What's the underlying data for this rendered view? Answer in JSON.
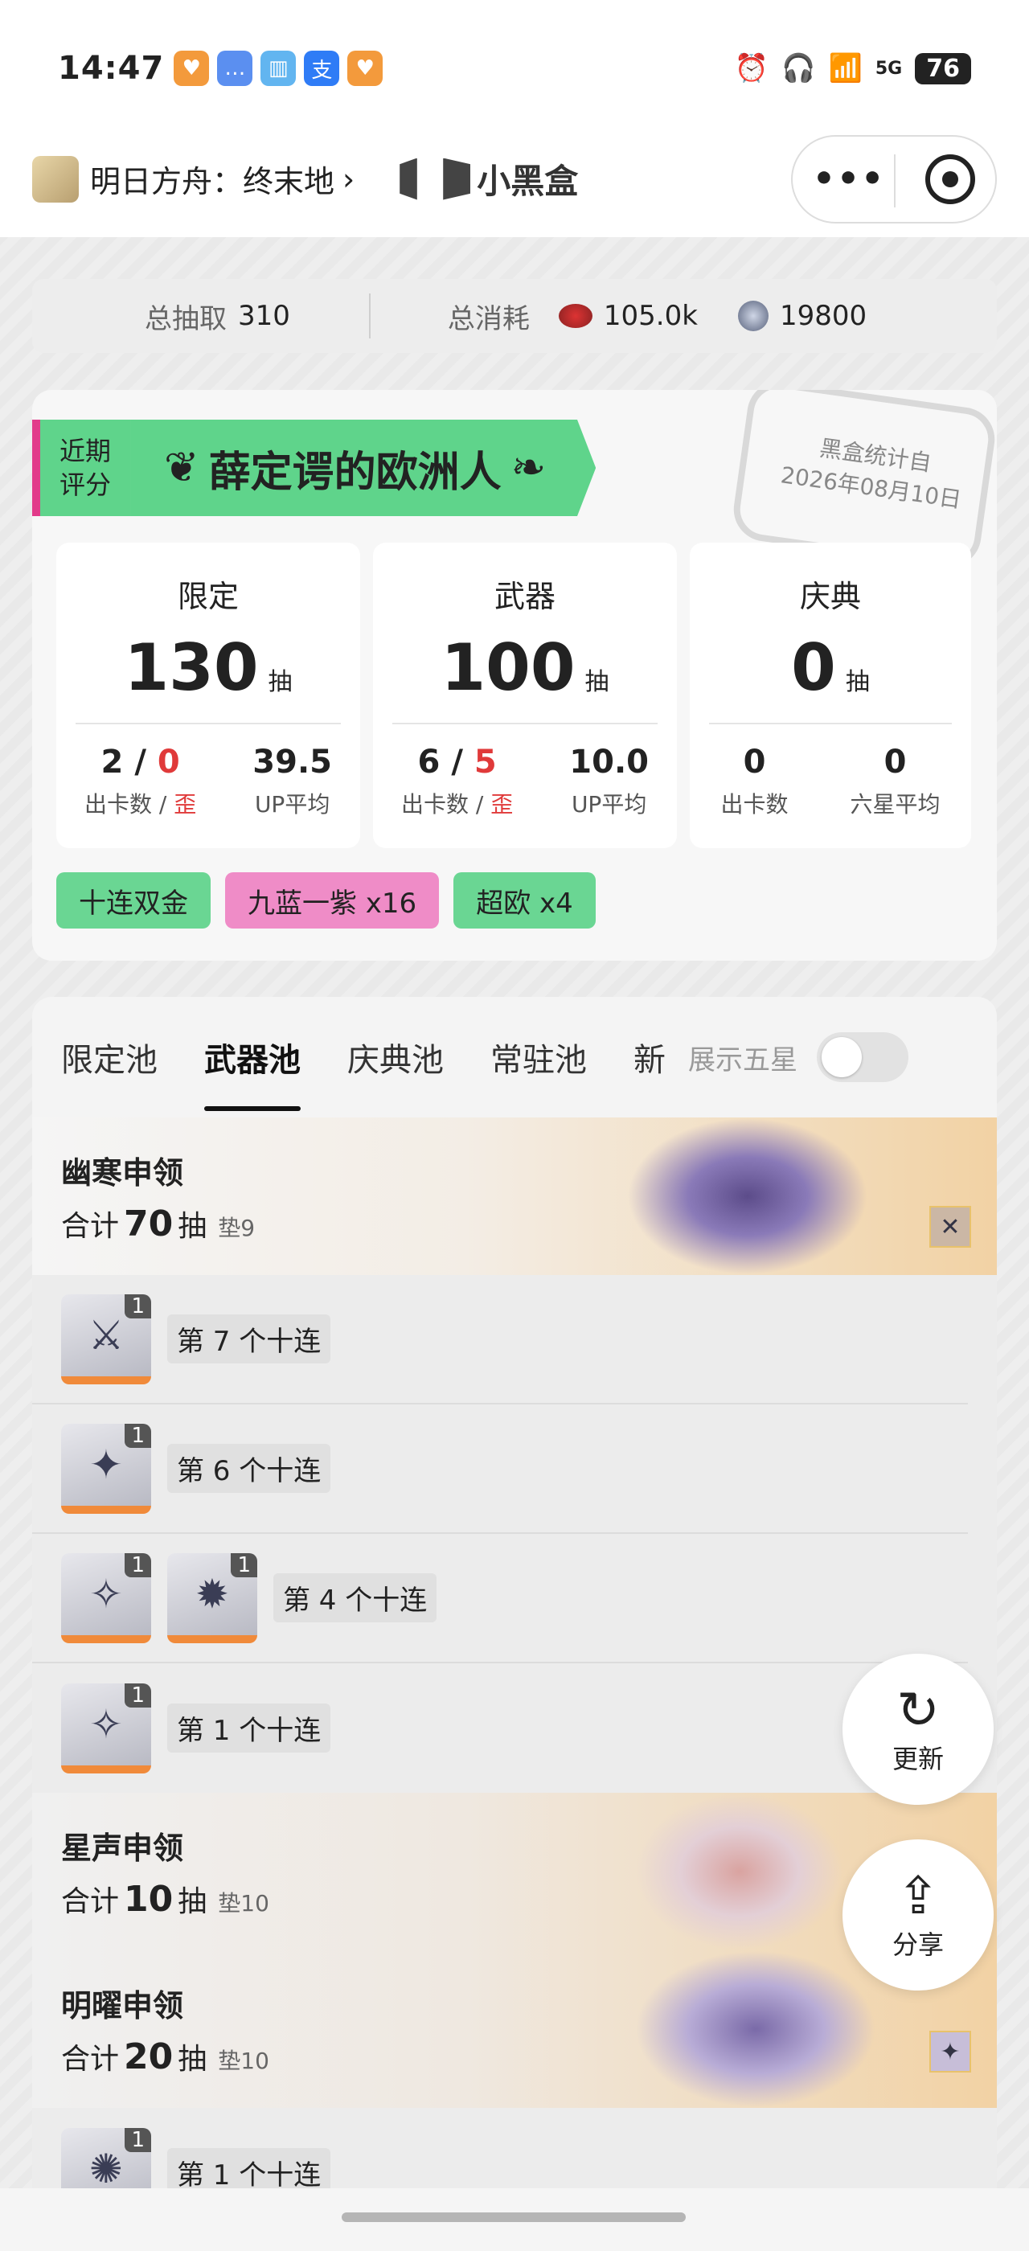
{
  "status": {
    "time": "14:47",
    "network": "5G",
    "battery": "76"
  },
  "nav": {
    "app_name": "明日方舟：终末地",
    "brand": "小黑盒"
  },
  "totals": {
    "total_pulls_label": "总抽取",
    "total_pulls_value": "310",
    "total_cost_label": "总消耗",
    "gem_value": "105.0k",
    "coin_value": "19800"
  },
  "rating": {
    "tag": "近期\n评分",
    "tag_line1": "近期",
    "tag_line2": "评分",
    "title": "薛定谔的欧洲人",
    "stamp_line1": "黑盒统计自",
    "stamp_line2": "2026年08月10日"
  },
  "pool_cards": [
    {
      "title": "限定",
      "count": "130",
      "unit": "抽",
      "stat1_a": "2",
      "stat1_sep": " / ",
      "stat1_b": "0",
      "stat1_label_a": "出卡数 / ",
      "stat1_label_b": "歪",
      "stat2": "39.5",
      "stat2_label": "UP平均"
    },
    {
      "title": "武器",
      "count": "100",
      "unit": "抽",
      "stat1_a": "6",
      "stat1_sep": " / ",
      "stat1_b": "5",
      "stat1_label_a": "出卡数 / ",
      "stat1_label_b": "歪",
      "stat2": "10.0",
      "stat2_label": "UP平均"
    },
    {
      "title": "庆典",
      "count": "0",
      "unit": "抽",
      "stat1_a": "0",
      "stat1_label_a": "出卡数",
      "stat2": "0",
      "stat2_label": "六星平均"
    }
  ],
  "tags": [
    {
      "label": "十连双金",
      "color": "#6ad693"
    },
    {
      "label": "九蓝一紫 x16",
      "color": "#ef8cc7"
    },
    {
      "label": "超欧 x4",
      "color": "#6ad693"
    }
  ],
  "tabs": [
    "限定池",
    "武器池",
    "庆典池",
    "常驻池",
    "新"
  ],
  "active_tab": "武器池",
  "toggle_label": "展示五星",
  "banners": [
    {
      "title": "幽寒申领",
      "total_label": "合计",
      "total": "70",
      "unit": "抽",
      "pad": "垫9"
    },
    {
      "title": "星声申领",
      "total_label": "合计",
      "total": "10",
      "unit": "抽",
      "pad": "垫10"
    },
    {
      "title": "明曜申领",
      "total_label": "合计",
      "total": "20",
      "unit": "抽",
      "pad": "垫10"
    }
  ],
  "pulls": [
    {
      "label": "第 7 个十连",
      "count": "1"
    },
    {
      "label": "第 6 个十连",
      "count": "1"
    },
    {
      "label": "第 4 个十连",
      "count": "1"
    },
    {
      "label": "第 1 个十连",
      "count": "1"
    },
    {
      "label": "第 1 个十连",
      "count": "1"
    }
  ],
  "fab": {
    "refresh": "更新",
    "share": "分享"
  },
  "colors": {
    "accent_green": "#5fd48b",
    "accent_pink": "#e23b8a",
    "rarity_orange": "#f08a3a",
    "red": "#e03a3a"
  }
}
